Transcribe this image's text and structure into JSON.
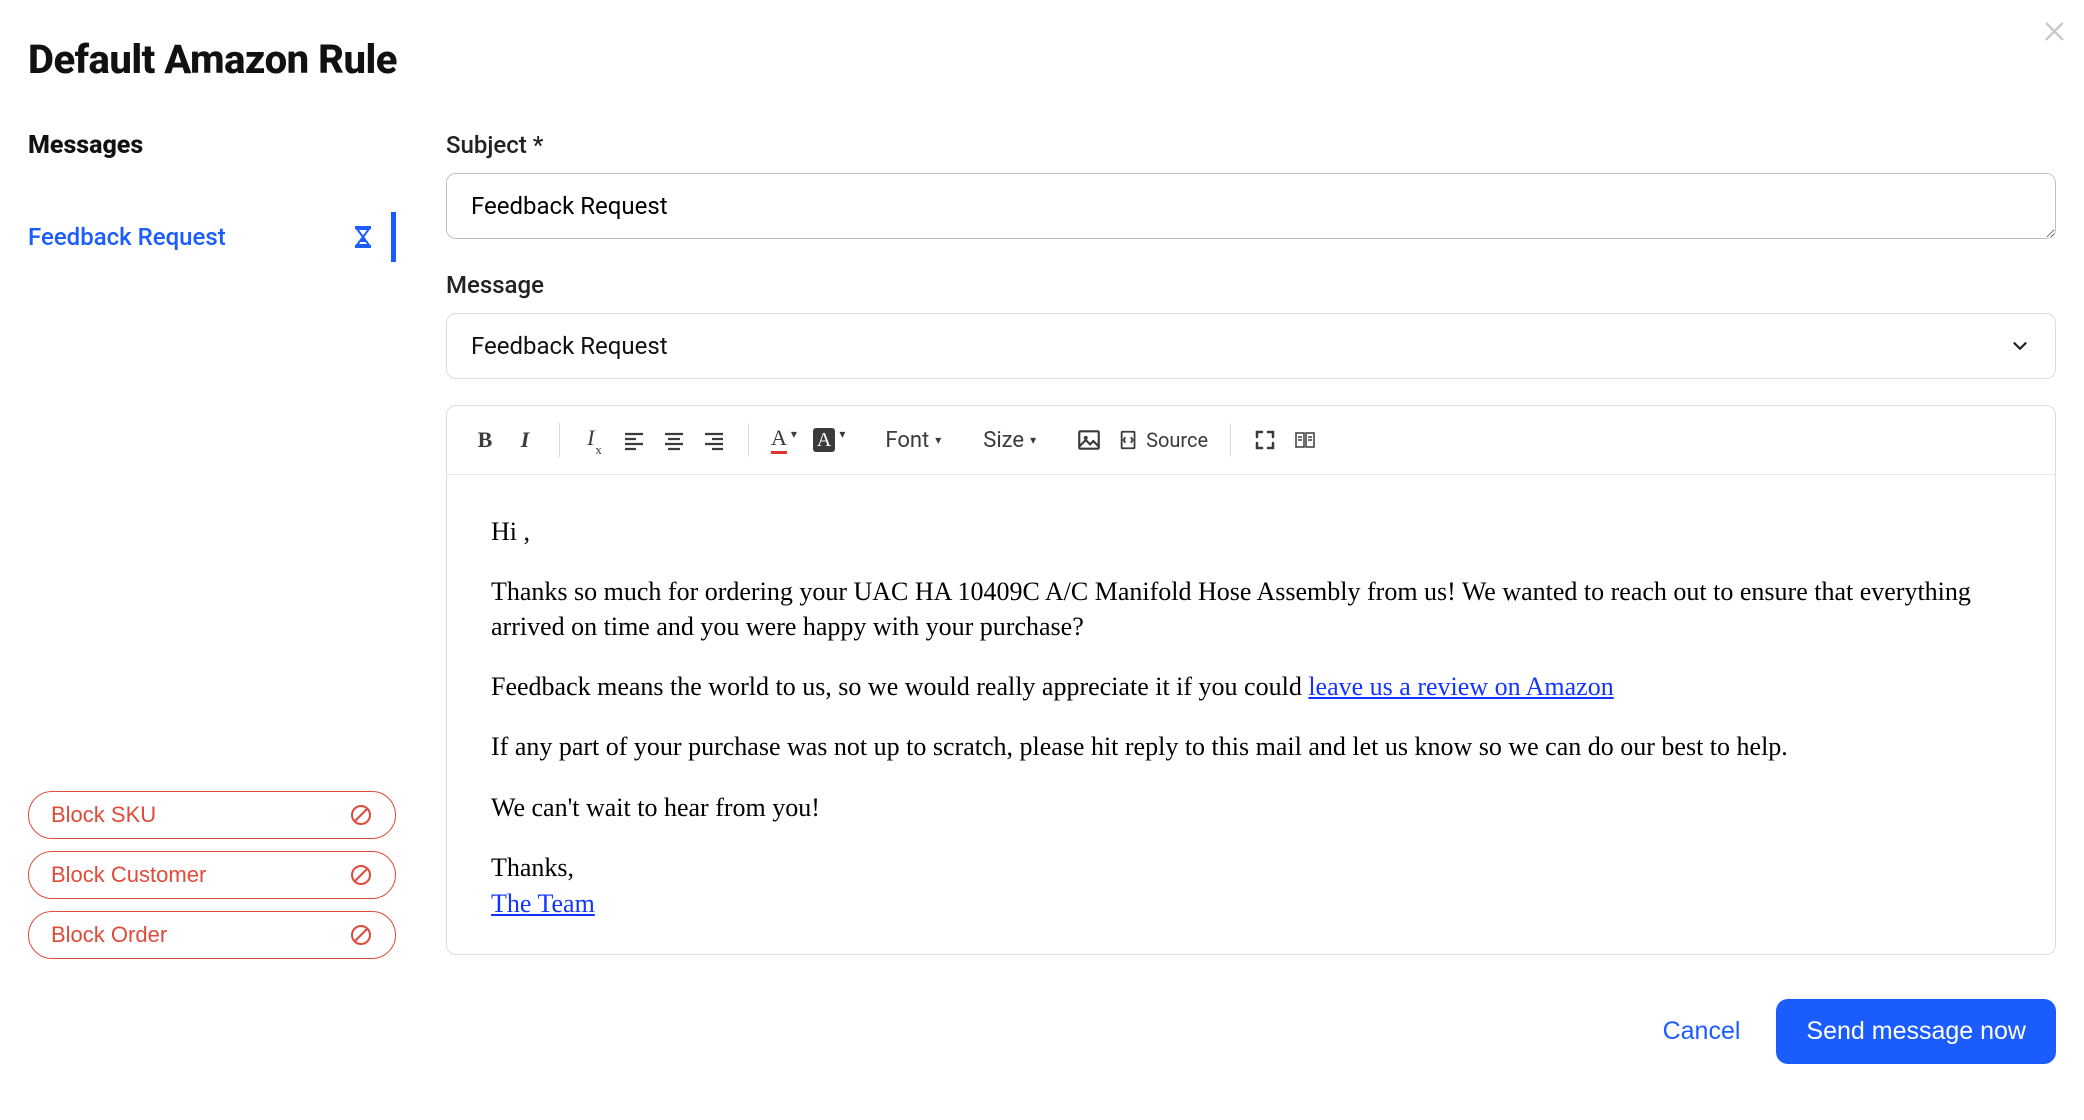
{
  "page": {
    "title": "Default Amazon Rule"
  },
  "sidebar": {
    "heading": "Messages",
    "items": [
      {
        "label": "Feedback Request",
        "active": true
      }
    ],
    "block_buttons": [
      {
        "label": "Block SKU"
      },
      {
        "label": "Block Customer"
      },
      {
        "label": "Block Order"
      }
    ]
  },
  "form": {
    "subject_label": "Subject *",
    "subject_value": "Feedback Request",
    "message_label": "Message",
    "template_select": {
      "selected": "Feedback Request"
    }
  },
  "toolbar": {
    "font_label": "Font",
    "size_label": "Size",
    "source_label": "Source"
  },
  "body": {
    "greeting": "Hi ,",
    "p1": "Thanks so much for ordering your UAC HA 10409C A/C Manifold Hose Assembly from us! We wanted to reach out to ensure that everything arrived on time and you were happy with your purchase?",
    "p2_pre": "Feedback means the world to us, so we would really appreciate it if you could ",
    "p2_link": "leave us a review on Amazon",
    "p3": "If any part of your purchase was not up to scratch, please hit reply to this mail and let us know so we can do our best to help.",
    "p4": "We can't wait to hear from you!",
    "signoff": "Thanks,",
    "team_link": "The Team"
  },
  "actions": {
    "cancel": "Cancel",
    "send": "Send message now"
  }
}
